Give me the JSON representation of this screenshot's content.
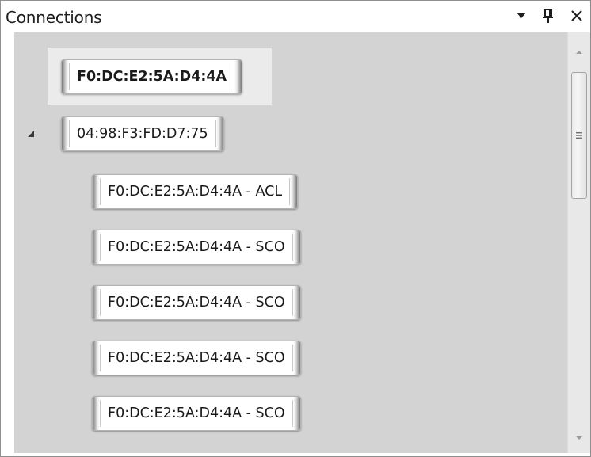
{
  "panel": {
    "title": "Connections",
    "buttons": {
      "menu_icon": "triangle-down-icon",
      "pin_icon": "pin-icon",
      "close_icon": "close-icon"
    }
  },
  "tree": {
    "nodes": [
      {
        "label": "F0:DC:E2:5A:D4:4A",
        "bold": true,
        "selected": true,
        "level": 0
      },
      {
        "label": "04:98:F3:FD:D7:75",
        "bold": false,
        "expanded": true,
        "level": 0
      },
      {
        "label": "F0:DC:E2:5A:D4:4A - ACL",
        "level": 1
      },
      {
        "label": "F0:DC:E2:5A:D4:4A - SCO",
        "level": 1
      },
      {
        "label": "F0:DC:E2:5A:D4:4A - SCO",
        "level": 1
      },
      {
        "label": "F0:DC:E2:5A:D4:4A - SCO",
        "level": 1
      },
      {
        "label": "F0:DC:E2:5A:D4:4A - SCO",
        "level": 1
      }
    ]
  },
  "colors": {
    "tree_background": "#d3d3d3",
    "selected_row": "#ebebeb",
    "panel_border": "#8e8e8e"
  }
}
